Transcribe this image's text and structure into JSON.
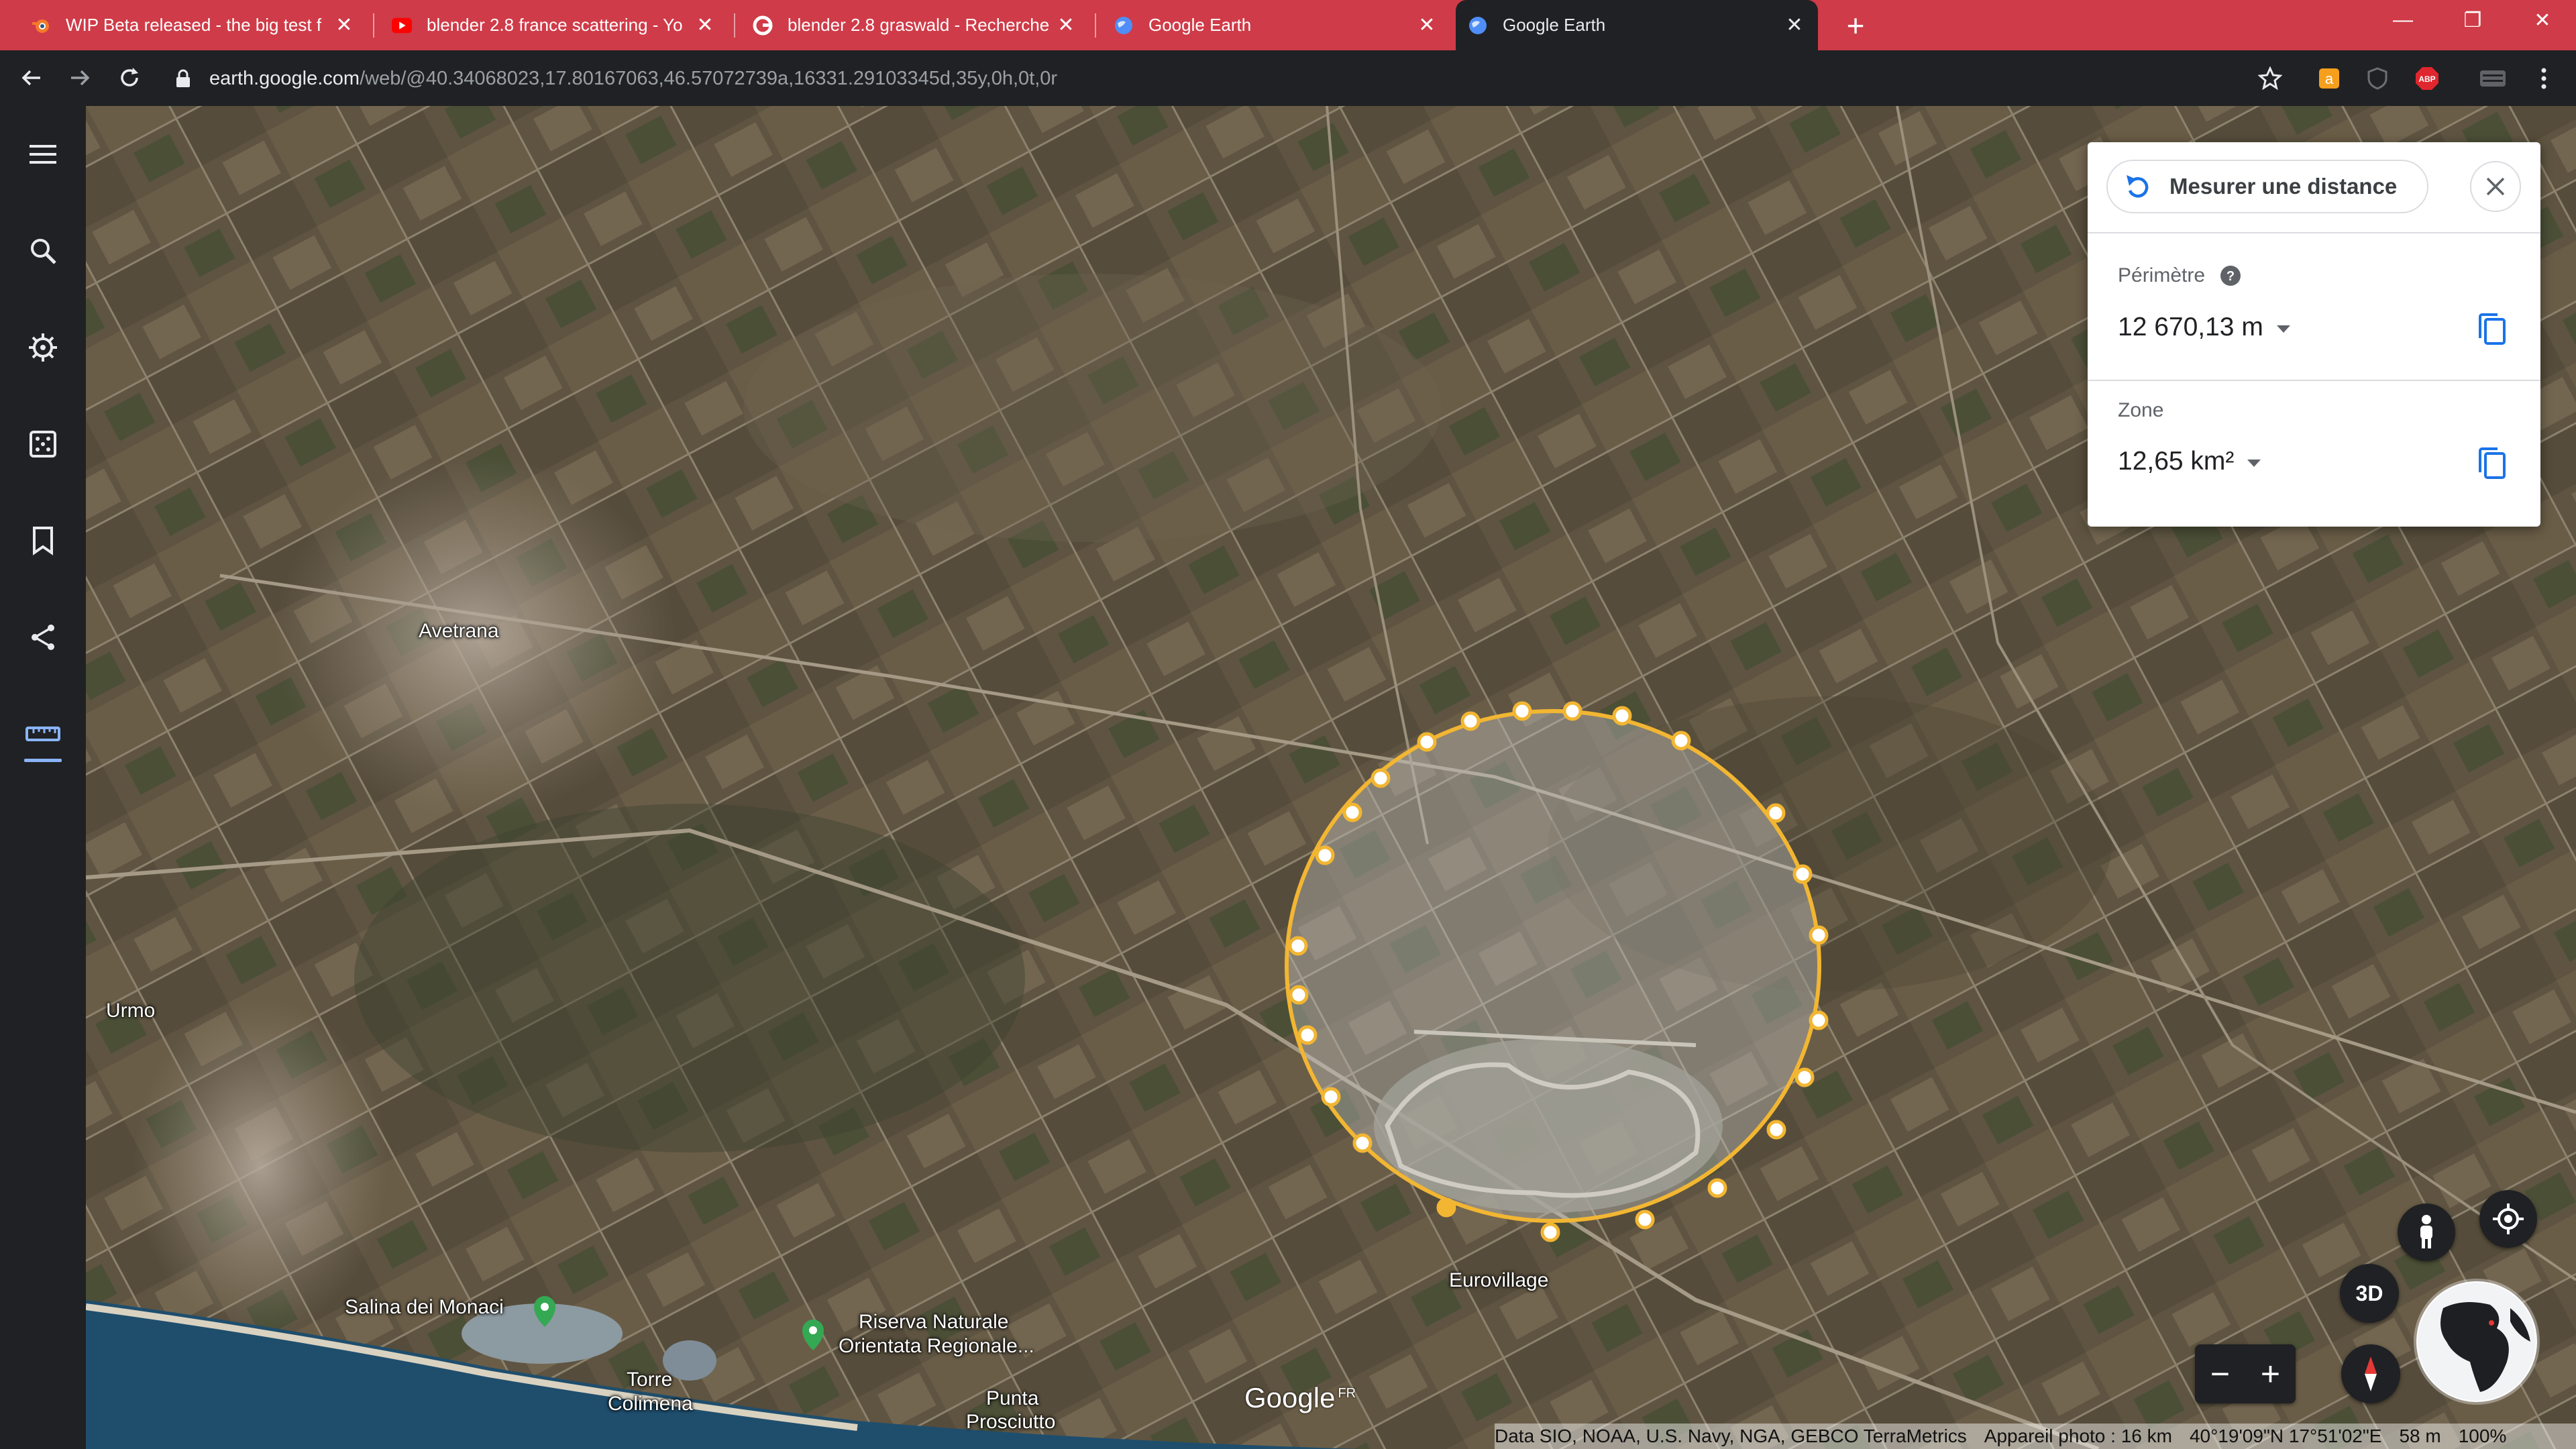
{
  "tabs": [
    {
      "title": "WIP Beta released - the big test f",
      "icon": "blender-icon"
    },
    {
      "title": "blender 2.8 france scattering - Yo",
      "icon": "youtube-icon"
    },
    {
      "title": "blender 2.8 graswald - Recherche",
      "icon": "google-icon"
    },
    {
      "title": "Google Earth",
      "icon": "earth-icon"
    },
    {
      "title": "Google Earth",
      "icon": "earth-icon",
      "active": true
    }
  ],
  "address_bar": {
    "host": "earth.google.com",
    "path": "/web/@40.34068023,17.80167063,46.57072739a,16331.29103345d,35y,0h,0t,0r"
  },
  "measure_panel": {
    "button_label": "Mesurer une distance",
    "perimeter_label": "Périmètre",
    "perimeter_value": "12 670,13 m",
    "area_label": "Zone",
    "area_value": "12,65 km²"
  },
  "map_labels": {
    "avetrana": "Avetrana",
    "urmo": "Urmo",
    "salina": "Salina dei Monaci",
    "riserva_1": "Riserva Naturale",
    "riserva_2": "Orientata Regionale...",
    "torre_1": "Torre",
    "torre_2": "Colimena",
    "punta_1": "Punta",
    "punta_2": "Prosciutto",
    "eurovillage": "Eurovillage"
  },
  "controls": {
    "mode_3d": "3D"
  },
  "branding": {
    "logo": "Google",
    "region": "FR"
  },
  "attribution": {
    "data": "Data SIO, NOAA, U.S. Navy, NGA, GEBCO TerraMetrics",
    "camera": "Appareil photo : 16 km",
    "coords": "40°19'09\"N 17°51'02\"E",
    "elevation": "58 m",
    "zoom": "100%"
  },
  "colors": {
    "tab_strip": "#cf3b48",
    "chrome_dark": "#202124",
    "accent_blue": "#1a73e8",
    "measure_line": "#f2b632"
  }
}
